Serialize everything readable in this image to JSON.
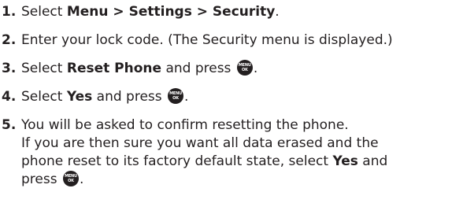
{
  "steps": [
    {
      "number": "1.",
      "pre": "Select ",
      "bold": "Menu > Settings > Security",
      "post": "."
    },
    {
      "number": "2.",
      "text": "Enter your lock code. (The Security menu is displayed.)"
    },
    {
      "number": "3.",
      "pre": "Select ",
      "bold": "Reset Phone",
      "mid": " and press ",
      "post": "."
    },
    {
      "number": "4.",
      "pre": "Select ",
      "bold": "Yes",
      "mid": " and press ",
      "post": "."
    },
    {
      "number": "5.",
      "line1": "You will be asked to confirm resetting the phone.",
      "line2": "If you are then sure you want all data erased and the",
      "line3_pre": "phone reset to its factory default state, select ",
      "line3_bold": "Yes",
      "line3_post": " and",
      "line4_pre": "press ",
      "line4_post": "."
    }
  ],
  "icon": {
    "name": "menu-ok-icon",
    "top": "MENU",
    "bottom": "OK"
  }
}
